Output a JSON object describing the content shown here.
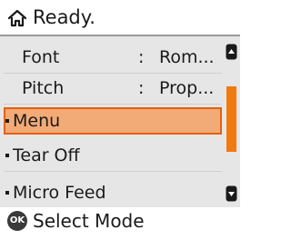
{
  "header": {
    "status": "Ready.",
    "icon": "home-icon"
  },
  "menu": {
    "items": [
      {
        "label": "Font",
        "value": "Rom...",
        "separator": ":"
      },
      {
        "label": "Pitch",
        "value": "Prop...",
        "separator": ":"
      },
      {
        "label": "Menu",
        "selected": true
      },
      {
        "label": "Tear Off"
      },
      {
        "label": "Micro Feed"
      }
    ]
  },
  "scrollbar": {
    "up_icon": "scroll-up-icon",
    "down_icon": "scroll-down-icon"
  },
  "footer": {
    "button_glyph": "OK",
    "action": "Select Mode",
    "icon": "ok-button-icon"
  },
  "colors": {
    "selection_fill": "#f2ab76",
    "selection_border": "#e85f0d",
    "scroll_thumb": "#f07a10",
    "menu_background": "#e6e6e6"
  }
}
